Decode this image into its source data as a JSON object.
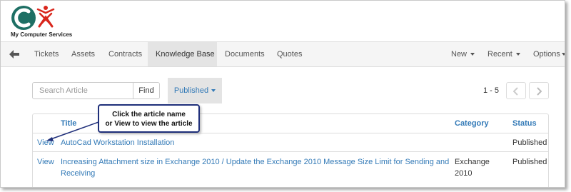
{
  "brand": {
    "name": "My Computer Services"
  },
  "nav": {
    "items": [
      {
        "label": "Tickets"
      },
      {
        "label": "Assets"
      },
      {
        "label": "Contracts"
      },
      {
        "label": "Knowledge Base"
      },
      {
        "label": "Documents"
      },
      {
        "label": "Quotes"
      }
    ],
    "right": [
      {
        "label": "New"
      },
      {
        "label": "Recent"
      },
      {
        "label": "Options"
      }
    ]
  },
  "toolbar": {
    "search_placeholder": "Search Article",
    "find_label": "Find",
    "filter_label": "Published",
    "pager_text": "1 - 5"
  },
  "table": {
    "headers": [
      "Title",
      "Category",
      "Status"
    ],
    "rows": [
      {
        "action": "View",
        "title": "AutoCad Workstation Installation",
        "category": "",
        "status": "Published"
      },
      {
        "action": "View",
        "title_line1": "Increasing Attachment size in Exchange 2010 / Update the Exchange 2010 Message Size Limit for Sending and",
        "title_line2": "Receiving",
        "category_line1": "Exchange",
        "category_line2": "2010",
        "status": "Published"
      }
    ]
  },
  "callout": {
    "line1": "Click the article name",
    "line2": "or View to view the article"
  },
  "colors": {
    "link": "#337ab7",
    "logo_teal": "#1e6f64",
    "logo_red": "#d9261c",
    "callout_border": "#1f2f7a"
  }
}
